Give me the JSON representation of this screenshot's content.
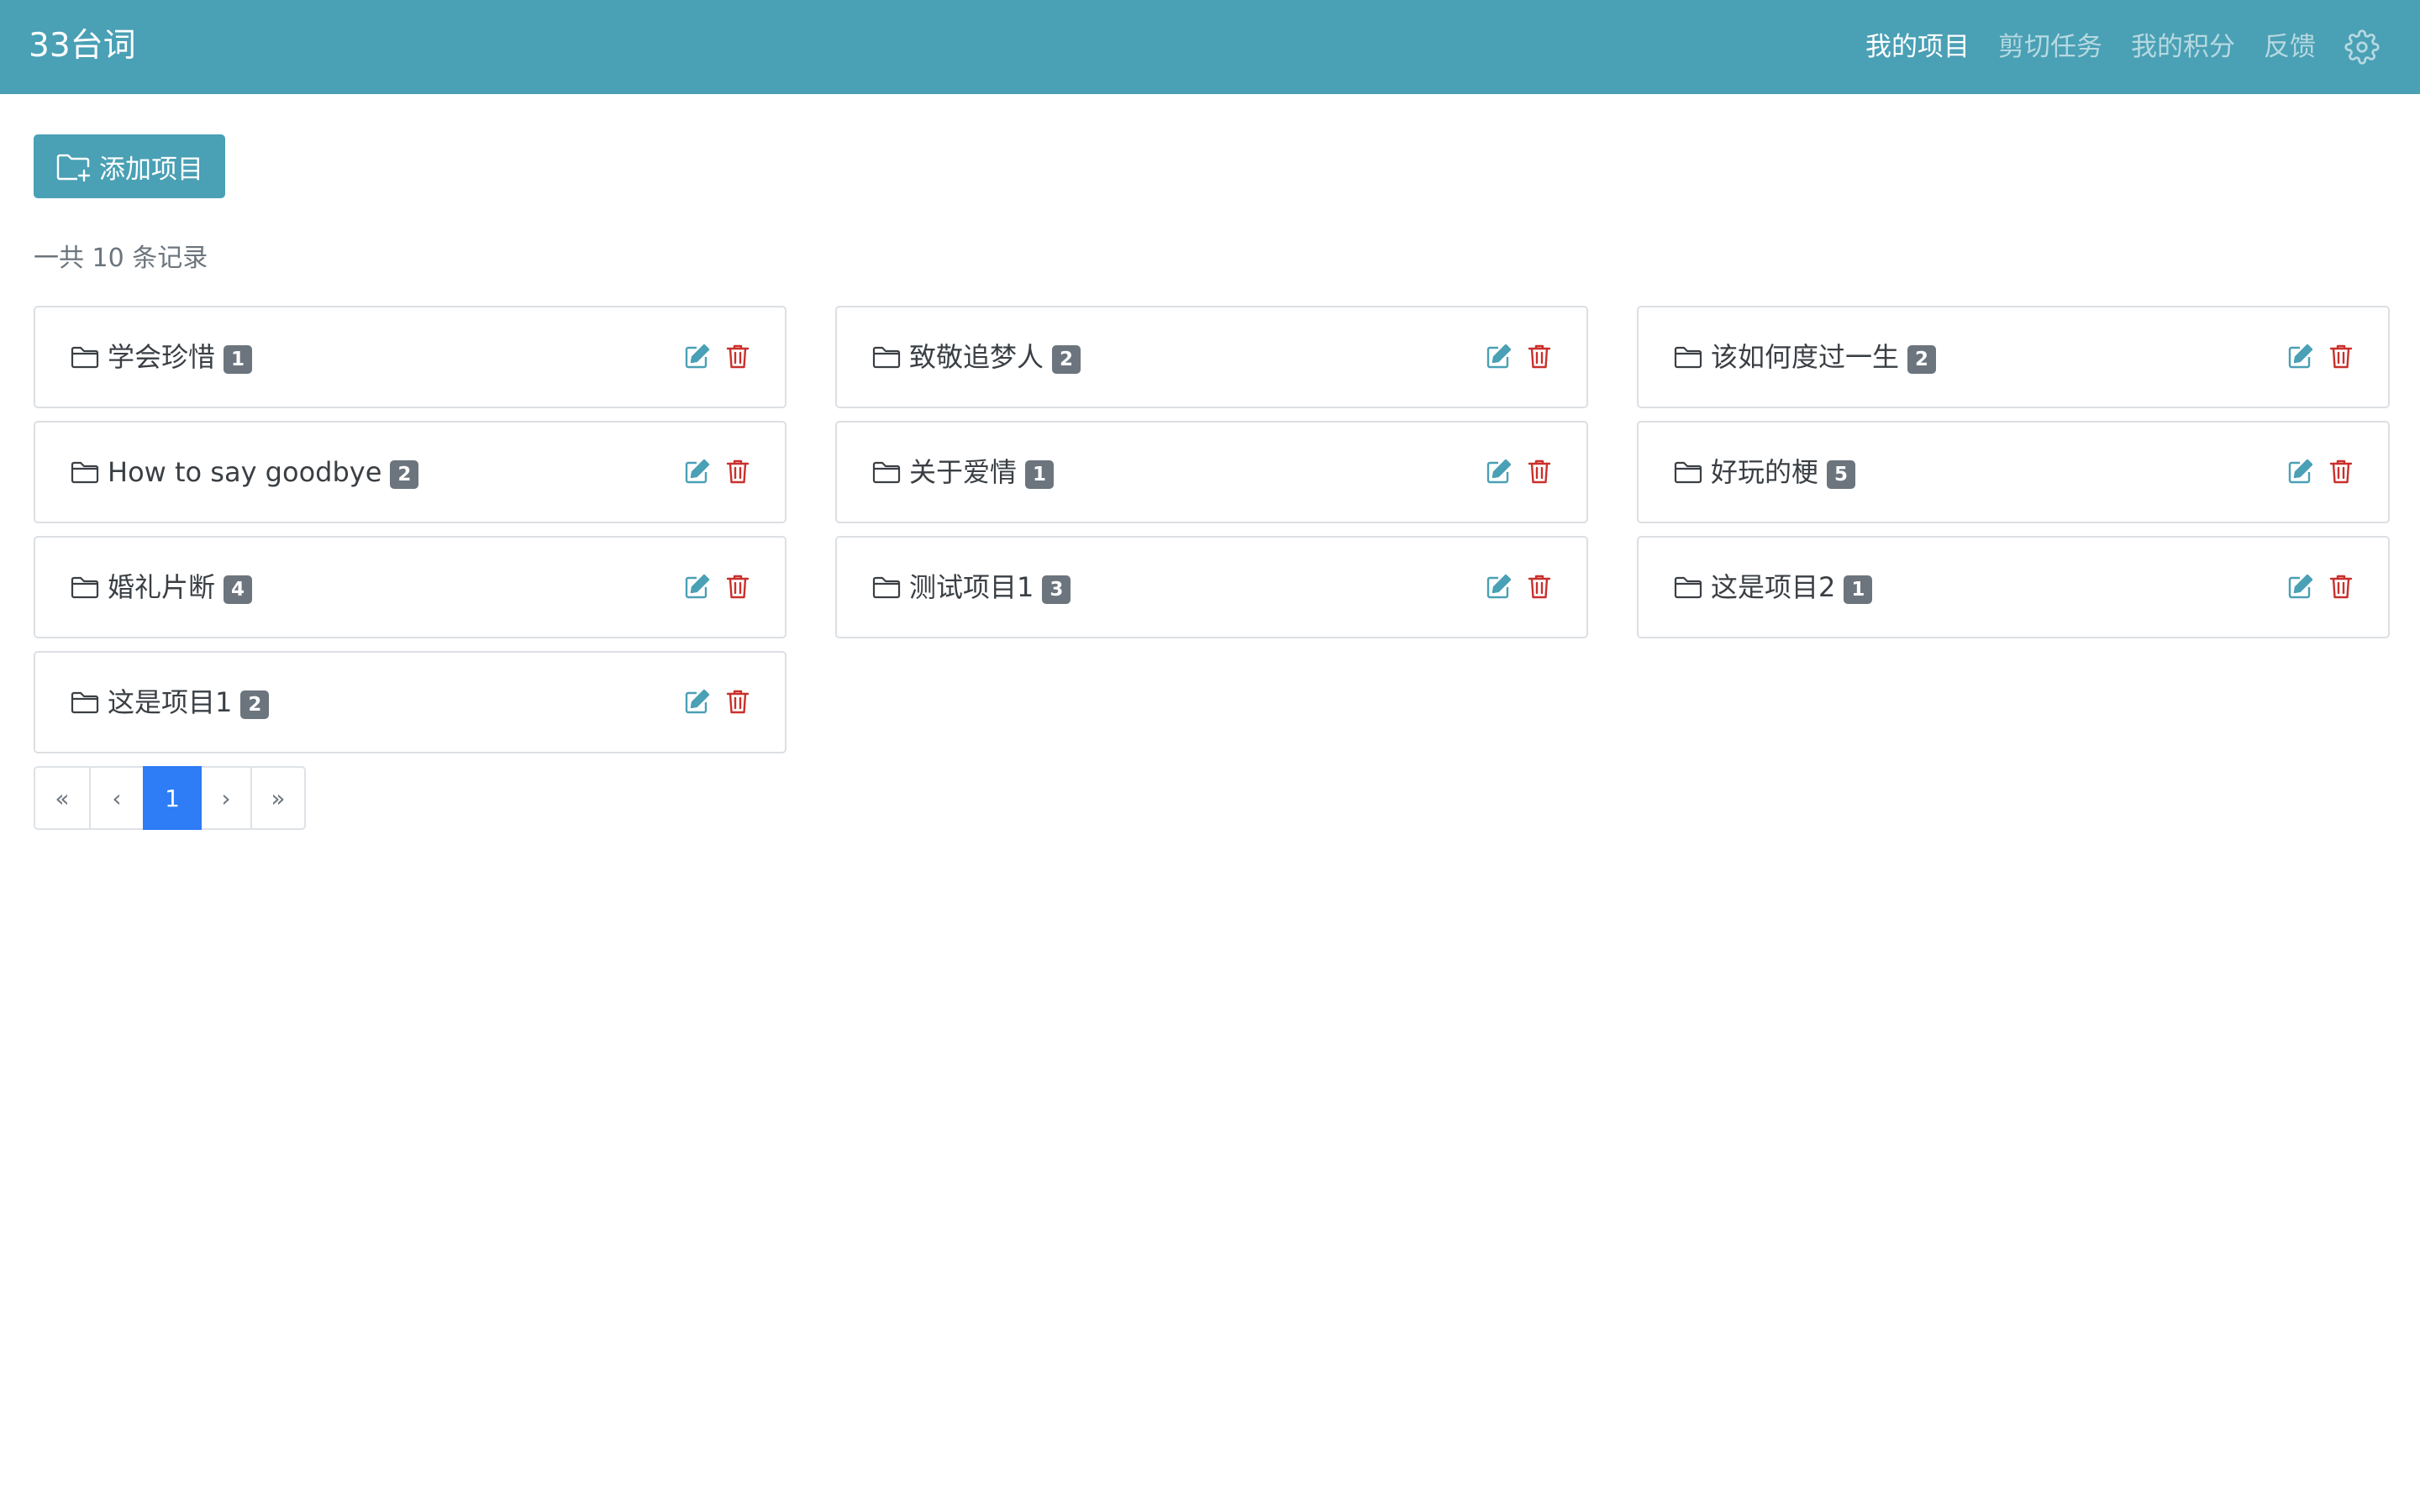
{
  "app": {
    "brand": "33台词"
  },
  "nav": {
    "items": [
      {
        "label": "我的项目",
        "active": true
      },
      {
        "label": "剪切任务",
        "active": false
      },
      {
        "label": "我的积分",
        "active": false
      },
      {
        "label": "反馈",
        "active": false
      }
    ],
    "settings_icon": "gear-icon"
  },
  "toolbar": {
    "add_label": "添加项目",
    "add_icon": "folder-plus-icon"
  },
  "summary": {
    "text": "一共 10 条记录"
  },
  "projects": [
    {
      "title": "学会珍惜",
      "count": "1"
    },
    {
      "title": "致敬追梦人",
      "count": "2"
    },
    {
      "title": "该如何度过一生",
      "count": "2"
    },
    {
      "title": "How to say goodbye",
      "count": "2"
    },
    {
      "title": "关于爱情",
      "count": "1"
    },
    {
      "title": "好玩的梗",
      "count": "5"
    },
    {
      "title": "婚礼片断",
      "count": "4"
    },
    {
      "title": "测试项目1",
      "count": "3"
    },
    {
      "title": "这是项目2",
      "count": "1"
    },
    {
      "title": "这是项目1",
      "count": "2"
    }
  ],
  "pagination": {
    "first": "«",
    "prev": "‹",
    "current": "1",
    "next": "›",
    "last": "»"
  },
  "colors": {
    "primary": "#4aa0b5",
    "active_page": "#2e7cf6",
    "badge": "#6c757d",
    "edit_icon": "#4aa0b5",
    "delete_icon": "#c9302c"
  }
}
